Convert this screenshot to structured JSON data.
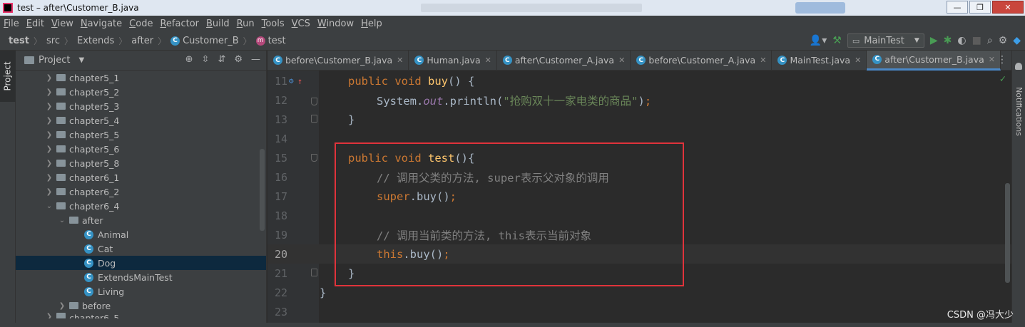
{
  "window": {
    "title": "test – after\\Customer_B.java",
    "controls": [
      "—",
      "❐",
      "✕"
    ]
  },
  "menu": [
    {
      "u": "F",
      "rest": "ile"
    },
    {
      "u": "E",
      "rest": "dit"
    },
    {
      "u": "V",
      "rest": "iew"
    },
    {
      "u": "N",
      "rest": "avigate"
    },
    {
      "u": "C",
      "rest": "ode"
    },
    {
      "u": "R",
      "rest": "efactor"
    },
    {
      "u": "B",
      "rest": "uild"
    },
    {
      "u": "R",
      "rest": "un"
    },
    {
      "u": "T",
      "rest": "ools"
    },
    {
      "u": "V",
      "rest": "CS"
    },
    {
      "u": "W",
      "rest": "indow"
    },
    {
      "u": "H",
      "rest": "elp"
    }
  ],
  "breadcrumb": {
    "project": "test",
    "src": "src",
    "pkg1": "Extends",
    "pkg2": "after",
    "cls": "Customer_B",
    "method": "test"
  },
  "run_config": "MainTest",
  "project_panel": {
    "title": "Project",
    "strip_label": "Project",
    "tree": {
      "chapter5_1": "chapter5_1",
      "chapter5_2": "chapter5_2",
      "chapter5_3": "chapter5_3",
      "chapter5_4": "chapter5_4",
      "chapter5_5": "chapter5_5",
      "chapter5_6": "chapter5_6",
      "chapter5_8": "chapter5_8",
      "chapter6_1": "chapter6_1",
      "chapter6_2": "chapter6_2",
      "chapter6_4": "chapter6_4",
      "after": "after",
      "animal": "Animal",
      "cat": "Cat",
      "dog": "Dog",
      "extendsmaintest": "ExtendsMainTest",
      "living": "Living",
      "before": "before",
      "chapter6_5": "chapter6_5"
    }
  },
  "tabs": [
    {
      "label": "before\\Customer_B.java"
    },
    {
      "label": "Human.java"
    },
    {
      "label": "after\\Customer_A.java"
    },
    {
      "label": "before\\Customer_A.java"
    },
    {
      "label": "MainTest.java"
    },
    {
      "label": "after\\Customer_B.java",
      "active": true
    }
  ],
  "right_strip_label": "Notifications",
  "editor": {
    "line_numbers": [
      "11",
      "12",
      "13",
      "14",
      "15",
      "16",
      "17",
      "18",
      "19",
      "20",
      "21",
      "22",
      "23"
    ],
    "current_line": "20",
    "code": {
      "l11_kw1": "public",
      "l11_kw2": "void",
      "l11_fn": "buy",
      "l11_rest": "() {",
      "l12_a": "System.",
      "l12_field": "out",
      "l12_b": ".println(",
      "l12_str": "\"抢购双十一家电类的商品\"",
      "l12_c": ")",
      "l12_semi": ";",
      "l13": "}",
      "l15_kw1": "public",
      "l15_kw2": "void",
      "l15_fn": "test",
      "l15_rest": "(){",
      "l16": "// 调用父类的方法, super表示父对象的调用",
      "l17_kw": "super",
      "l17_rest": ".buy()",
      "l17_semi": ";",
      "l19": "// 调用当前类的方法, this表示当前对象",
      "l20_kw": "this",
      "l20_rest": ".buy()",
      "l20_semi": ";",
      "l21": "}",
      "l22": "}"
    }
  },
  "watermark": "CSDN @冯大少"
}
